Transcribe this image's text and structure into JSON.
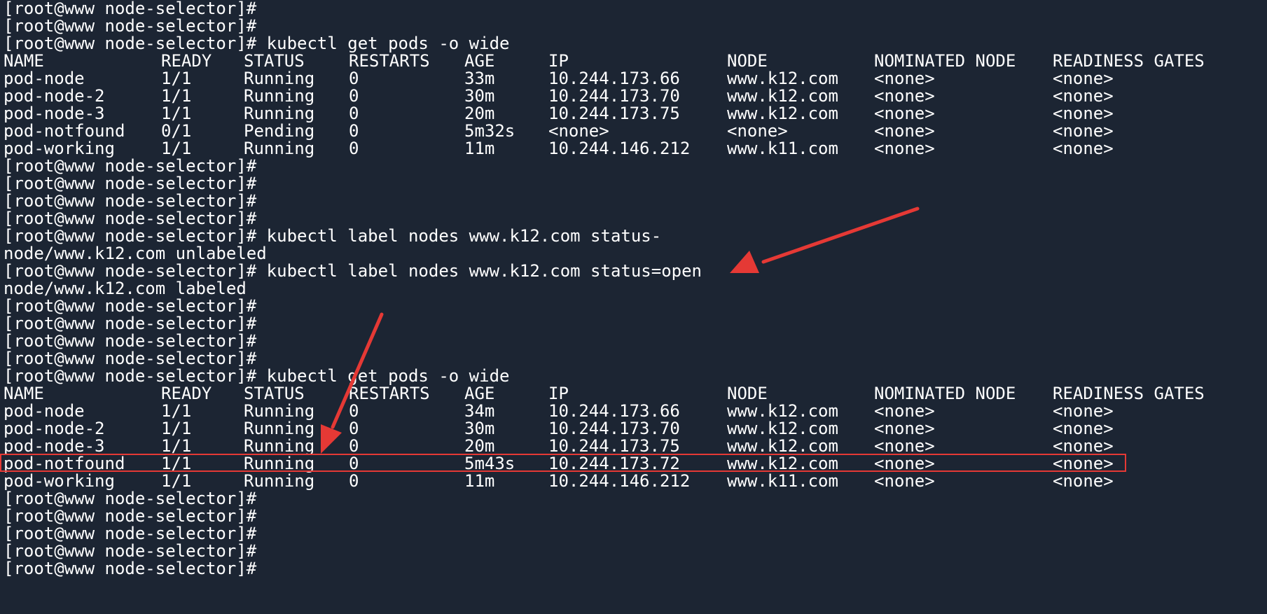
{
  "colors": {
    "background": "#1c2533",
    "text": "#ffffff",
    "annotation": "#e53935"
  },
  "lines": [
    "[root@www node-selector]#",
    "[root@www node-selector]#",
    "[root@www node-selector]# kubectl get pods -o wide"
  ],
  "table1": {
    "header": [
      "NAME",
      "READY",
      "STATUS",
      "RESTARTS",
      "AGE",
      "IP",
      "NODE",
      "NOMINATED NODE",
      "READINESS GATES"
    ],
    "rows": [
      [
        "pod-node",
        "1/1",
        "Running",
        "0",
        "33m",
        "10.244.173.66",
        "www.k12.com",
        "<none>",
        "<none>"
      ],
      [
        "pod-node-2",
        "1/1",
        "Running",
        "0",
        "30m",
        "10.244.173.70",
        "www.k12.com",
        "<none>",
        "<none>"
      ],
      [
        "pod-node-3",
        "1/1",
        "Running",
        "0",
        "20m",
        "10.244.173.75",
        "www.k12.com",
        "<none>",
        "<none>"
      ],
      [
        "pod-notfound",
        "0/1",
        "Pending",
        "0",
        "5m32s",
        "<none>",
        "<none>",
        "<none>",
        "<none>"
      ],
      [
        "pod-working",
        "1/1",
        "Running",
        "0",
        "11m",
        "10.244.146.212",
        "www.k11.com",
        "<none>",
        "<none>"
      ]
    ]
  },
  "lines2": [
    "[root@www node-selector]#",
    "[root@www node-selector]#",
    "[root@www node-selector]#",
    "[root@www node-selector]#",
    "[root@www node-selector]# kubectl label nodes www.k12.com status-",
    "node/www.k12.com unlabeled",
    "[root@www node-selector]# kubectl label nodes www.k12.com status=open",
    "node/www.k12.com labeled",
    "[root@www node-selector]#",
    "[root@www node-selector]#",
    "[root@www node-selector]#",
    "[root@www node-selector]#",
    "[root@www node-selector]# kubectl get pods -o wide"
  ],
  "table2": {
    "header": [
      "NAME",
      "READY",
      "STATUS",
      "RESTARTS",
      "AGE",
      "IP",
      "NODE",
      "NOMINATED NODE",
      "READINESS GATES"
    ],
    "rows": [
      [
        "pod-node",
        "1/1",
        "Running",
        "0",
        "34m",
        "10.244.173.66",
        "www.k12.com",
        "<none>",
        "<none>"
      ],
      [
        "pod-node-2",
        "1/1",
        "Running",
        "0",
        "30m",
        "10.244.173.70",
        "www.k12.com",
        "<none>",
        "<none>"
      ],
      [
        "pod-node-3",
        "1/1",
        "Running",
        "0",
        "20m",
        "10.244.173.75",
        "www.k12.com",
        "<none>",
        "<none>"
      ],
      [
        "pod-notfound",
        "1/1",
        "Running",
        "0",
        "5m43s",
        "10.244.173.72",
        "www.k12.com",
        "<none>",
        "<none>"
      ],
      [
        "pod-working",
        "1/1",
        "Running",
        "0",
        "11m",
        "10.244.146.212",
        "www.k11.com",
        "<none>",
        "<none>"
      ]
    ]
  },
  "lines3": [
    "[root@www node-selector]#",
    "[root@www node-selector]#",
    "[root@www node-selector]#",
    "[root@www node-selector]#",
    "[root@www node-selector]#"
  ]
}
